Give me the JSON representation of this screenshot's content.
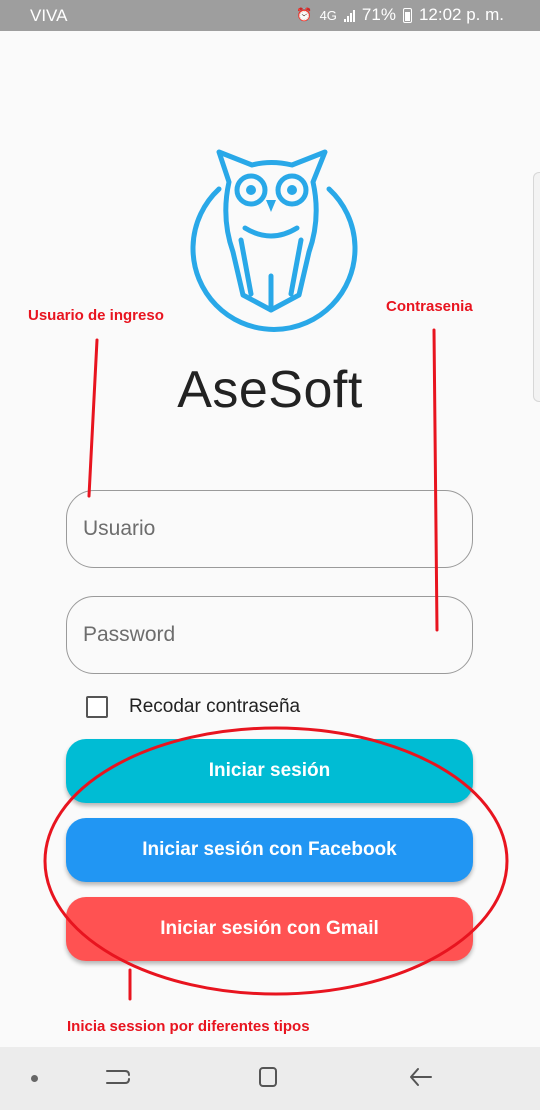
{
  "status_bar": {
    "carrier": "VIVA",
    "network": "4G",
    "battery": "71%",
    "time": "12:02 p. m."
  },
  "app": {
    "title": "AseSoft",
    "logo": "owl-logo-icon"
  },
  "form": {
    "username_placeholder": "Usuario",
    "password_placeholder": "Password",
    "remember_label": "Recodar contraseña",
    "remember_checked": false
  },
  "buttons": {
    "login": "Iniciar sesión",
    "facebook": "Iniciar sesión con Facebook",
    "gmail": "Iniciar sesión con Gmail"
  },
  "annotations": {
    "username": "Usuario de ingreso",
    "password": "Contrasenia",
    "login_types": "Inicia session por diferentes tipos",
    "color": "#e8141f"
  },
  "colors": {
    "login": "#00bcd4",
    "facebook": "#2196f3",
    "gmail": "#ff5252",
    "owl": "#29a8e8",
    "status_bar": "#9e9e9e"
  },
  "nav_bar": {
    "icons": [
      "dot-icon",
      "recents-icon",
      "home-icon",
      "back-icon"
    ]
  }
}
